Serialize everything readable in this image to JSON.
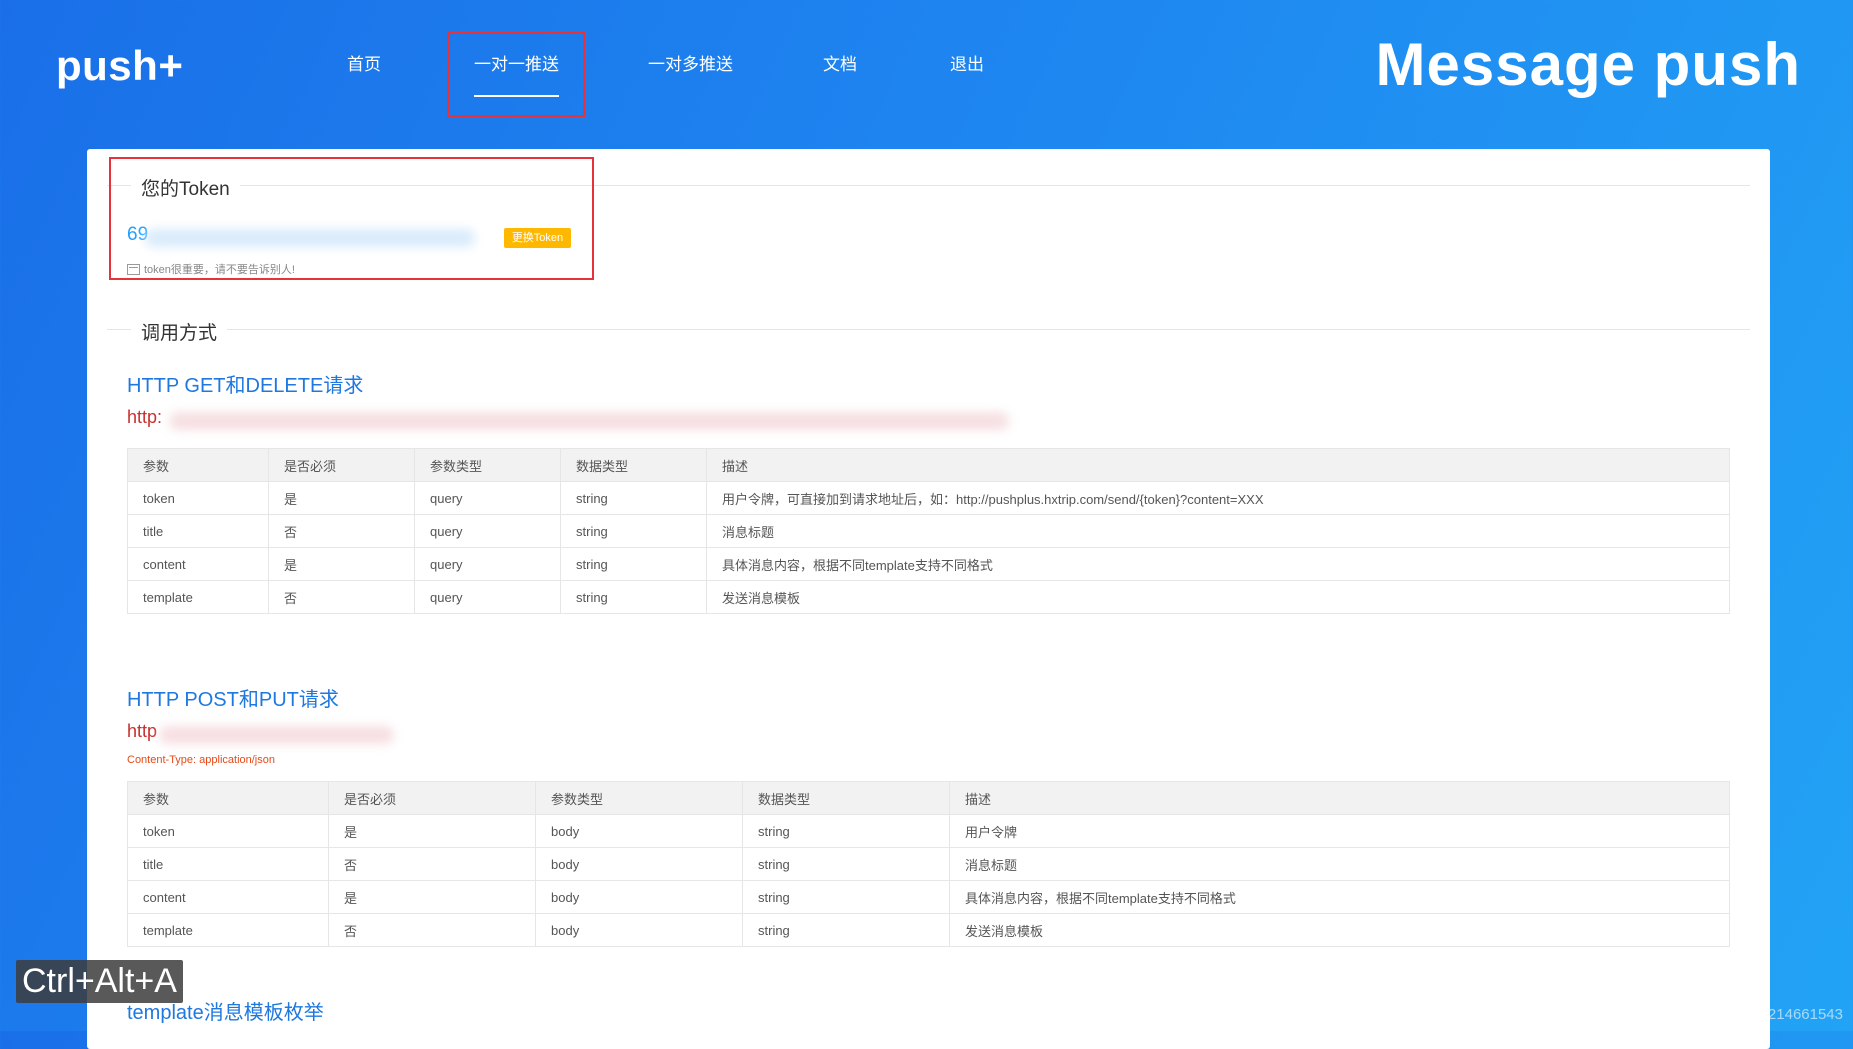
{
  "header": {
    "logo": "push+",
    "slogan": "Message push",
    "nav": [
      "首页",
      "一对一推送",
      "一对多推送",
      "文档",
      "退出"
    ]
  },
  "token_section": {
    "legend": "您的Token",
    "value_prefix": "69",
    "change_button": "更换Token",
    "tip": "token很重要，请不要告诉别人!"
  },
  "usage_section": {
    "legend": "调用方式"
  },
  "get_api": {
    "title": "HTTP GET和DELETE请求",
    "url_prefix": "http:",
    "headers": [
      "参数",
      "是否必须",
      "参数类型",
      "数据类型",
      "描述"
    ],
    "rows": [
      [
        "token",
        "是",
        "query",
        "string",
        "用户令牌，可直接加到请求地址后，如：http://pushplus.hxtrip.com/send/{token}?content=XXX"
      ],
      [
        "title",
        "否",
        "query",
        "string",
        "消息标题"
      ],
      [
        "content",
        "是",
        "query",
        "string",
        "具体消息内容，根据不同template支持不同格式"
      ],
      [
        "template",
        "否",
        "query",
        "string",
        "发送消息模板"
      ]
    ]
  },
  "post_api": {
    "title": "HTTP POST和PUT请求",
    "url_prefix": "http",
    "content_type": "Content-Type: application/json",
    "headers": [
      "参数",
      "是否必须",
      "参数类型",
      "数据类型",
      "描述"
    ],
    "rows": [
      [
        "token",
        "是",
        "body",
        "string",
        "用户令牌"
      ],
      [
        "title",
        "否",
        "body",
        "string",
        "消息标题"
      ],
      [
        "content",
        "是",
        "body",
        "string",
        "具体消息内容，根据不同template支持不同格式"
      ],
      [
        "template",
        "否",
        "body",
        "string",
        "发送消息模板"
      ]
    ]
  },
  "template_enum_title": "template消息模板枚举",
  "overlay": {
    "hotkey": "Ctrl+Alt+A",
    "watermark": "https://blog.csdn.net/li1214661543"
  },
  "colors": {
    "accent_link": "#1e78e0",
    "token_blue": "#1e9fff",
    "url_red": "#c9302c",
    "highlight_red": "#e5323b",
    "button_yellow": "#ffb800"
  }
}
